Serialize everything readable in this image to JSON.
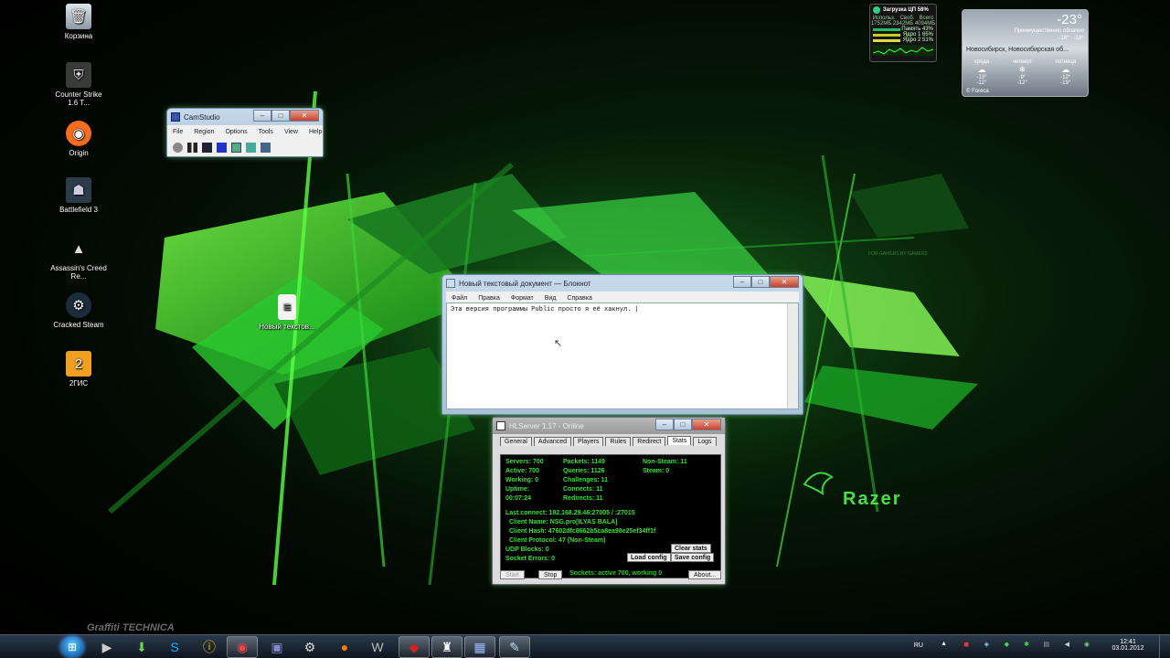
{
  "desktop_icons": [
    {
      "label": "Корзина",
      "icon": "recycle-bin-icon"
    },
    {
      "label": "Counter Strike 1.6 T...",
      "icon": "counter-strike-icon"
    },
    {
      "label": "Origin",
      "icon": "origin-icon"
    },
    {
      "label": "Battlefield 3",
      "icon": "battlefield-icon"
    },
    {
      "label": "Assassin's Creed Re...",
      "icon": "assassins-creed-icon"
    },
    {
      "label": "Cracked Steam",
      "icon": "steam-icon"
    },
    {
      "label": "2ГИС",
      "icon": "2gis-icon"
    },
    {
      "label": "Новый текстов...",
      "icon": "text-file-icon"
    }
  ],
  "notepad": {
    "title": "Новый текстовый документ — Блокнот",
    "menu": [
      "Файл",
      "Правка",
      "Формат",
      "Вид",
      "Справка"
    ],
    "content": "Эта версия программы Public просто я её хакнул. |"
  },
  "camstudio": {
    "title": "CamStudio",
    "menu": [
      "File",
      "Region",
      "Options",
      "Tools",
      "View",
      "Help"
    ]
  },
  "hlserver": {
    "title": "HLServer 1.17 - Online",
    "tabs": [
      "General",
      "Advanced",
      "Players",
      "Rules",
      "Redirect",
      "Stats",
      "Logs"
    ],
    "active_tab": "Stats",
    "col1": [
      "Servers: 700",
      "Active: 700",
      "Working: 0",
      "Uptime:",
      "00:07:24"
    ],
    "col2": [
      "Packets: 1149",
      "Queries: 1126",
      "Challenges: 11",
      "Connects: 11",
      "Redirects: 11"
    ],
    "col3": [
      "Non-Steam: 11",
      "Steam: 0"
    ],
    "details": [
      "Last connect: 192.168.29.46:27005 / :27015",
      "Client Name: NSG.pro[ILYAS BALA]",
      "Client Hash: 47602dfc8662b5ca8ea98e25ef34ff1f",
      "Client Protocol: 47 (Non-Steam)",
      "UDP Blocks: 0",
      "Socket Errors: 0"
    ],
    "buttons": {
      "clear_stats": "Clear stats",
      "load_config": "Load config",
      "save_config": "Save config",
      "start": "Start",
      "stop": "Stop",
      "about": "About..."
    },
    "sockets": "Sockets: active 700, working 0"
  },
  "cpu_gadget": {
    "title": "Загрузка ЦП 58%",
    "cols": [
      "Использ.",
      "Своб.",
      "Всего"
    ],
    "vals": [
      "1752МБ",
      "2342МБ",
      "4094МБ"
    ],
    "rows": [
      "Память 43%",
      "Ядро 1 65%",
      "Ядро 2 51%"
    ]
  },
  "weather": {
    "temp": "-23°",
    "cond": "Преимущественно облачно",
    "range": "-16° · -18°",
    "city": "Новосибирск, Новосибирская об...",
    "days": [
      {
        "name": "среда",
        "hi": "-13°",
        "lo": "-12°"
      },
      {
        "name": "четверг",
        "hi": "-9°",
        "lo": "-12°"
      },
      {
        "name": "пятница",
        "hi": "-12°",
        "lo": "-19°"
      }
    ],
    "source": "© Foreca"
  },
  "wallpaper": {
    "brand": "Razer",
    "tagline": "FOR GAMERS BY GAMERS"
  },
  "watermark": "Graffiti TECHNICA",
  "tray": {
    "lang": "RU",
    "time": "12:41",
    "date": "03.01.2012"
  }
}
